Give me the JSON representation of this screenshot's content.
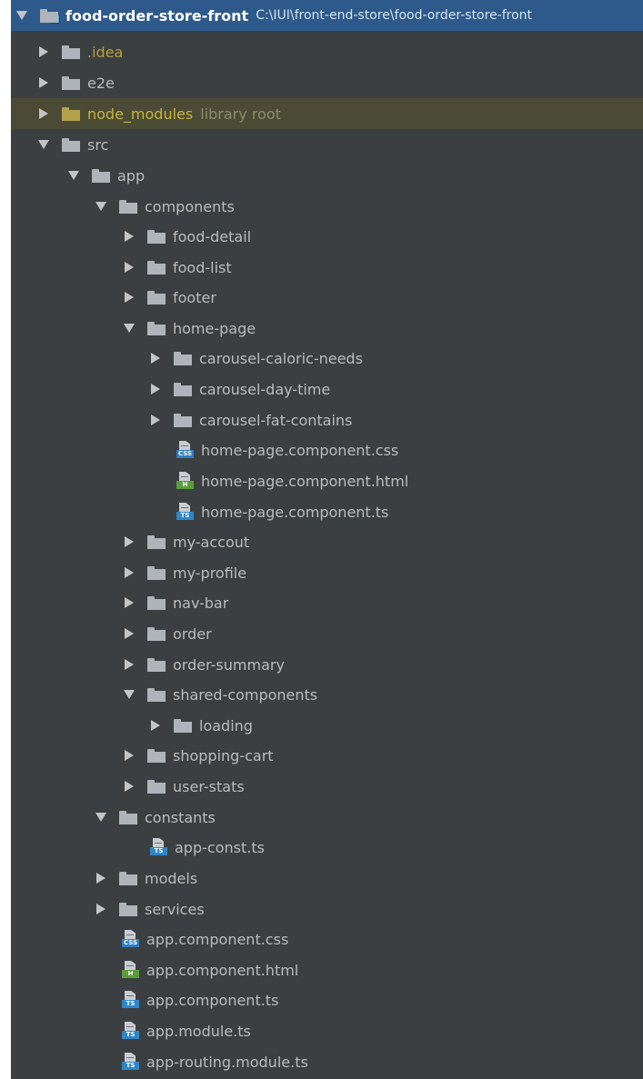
{
  "tree": {
    "root": {
      "name": "food-order-store-front",
      "path": "C:\\IUI\\front-end-store\\food-order-store-front"
    },
    "idea": ".idea",
    "e2e": "e2e",
    "node_modules": {
      "name": "node_modules",
      "suffix": "library root"
    },
    "src": "src",
    "app": "app",
    "components": "components",
    "food_detail": "food-detail",
    "food_list": "food-list",
    "footer": "footer",
    "home_page": "home-page",
    "carousel_caloric_needs": "carousel-caloric-needs",
    "carousel_day_time": "carousel-day-time",
    "carousel_fat_contains": "carousel-fat-contains",
    "home_page_css": "home-page.component.css",
    "home_page_html": "home-page.component.html",
    "home_page_ts": "home-page.component.ts",
    "my_accout": "my-accout",
    "my_profile": "my-profile",
    "nav_bar": "nav-bar",
    "order": "order",
    "order_summary": "order-summary",
    "shared_components": "shared-components",
    "loading": "loading",
    "shopping_cart": "shopping-cart",
    "user_stats": "user-stats",
    "constants": "constants",
    "app_const": "app-const.ts",
    "models": "models",
    "services": "services",
    "app_component_css": "app.component.css",
    "app_component_html": "app.component.html",
    "app_component_ts": "app.component.ts",
    "app_module": "app.module.ts",
    "app_routing": "app-routing.module.ts"
  },
  "file_tags": {
    "css": "CSS",
    "html": "H",
    "ts": "TS"
  },
  "colors": {
    "background": "#3c3f41",
    "selection": "#2d5a8a",
    "library_row": "#4b4b35",
    "library_text": "#c5b43d",
    "css_badge": "#2f7dc1",
    "html_badge": "#5b9d3c",
    "ts_badge": "#2f86c7"
  }
}
